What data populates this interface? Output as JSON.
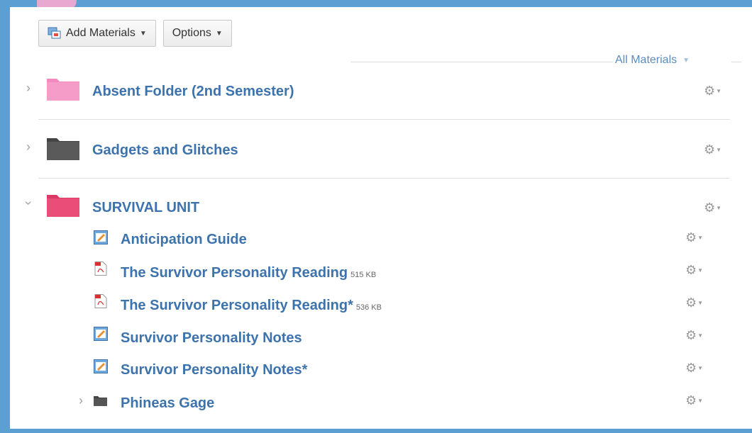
{
  "toolbar": {
    "add_materials_label": "Add Materials",
    "options_label": "Options"
  },
  "filter": {
    "label": "All Materials"
  },
  "colors": {
    "frame": "#5b9fd3",
    "link": "#3d73ad",
    "pink_folder": "#f28ac0",
    "dark_folder": "#555555",
    "red_folder": "#ea4d78"
  },
  "folders": [
    {
      "title": "Absent Folder (2nd Semester)",
      "color": "pink",
      "expanded": false
    },
    {
      "title": "Gadgets and Glitches",
      "color": "dark",
      "expanded": false
    },
    {
      "title": "SURVIVAL UNIT",
      "color": "red",
      "expanded": true
    }
  ],
  "survival_items": [
    {
      "title": "Anticipation Guide",
      "icon": "assignment-icon",
      "size": ""
    },
    {
      "title": "The Survivor Personality Reading",
      "icon": "pdf-icon",
      "size": "515 KB"
    },
    {
      "title": "The Survivor Personality Reading*",
      "icon": "pdf-icon",
      "size": "536 KB"
    },
    {
      "title": "Survivor Personality Notes",
      "icon": "assignment-icon",
      "size": ""
    },
    {
      "title": "Survivor Personality Notes*",
      "icon": "assignment-icon",
      "size": ""
    },
    {
      "title": "Phineas Gage",
      "icon": "folder-icon",
      "size": ""
    }
  ]
}
